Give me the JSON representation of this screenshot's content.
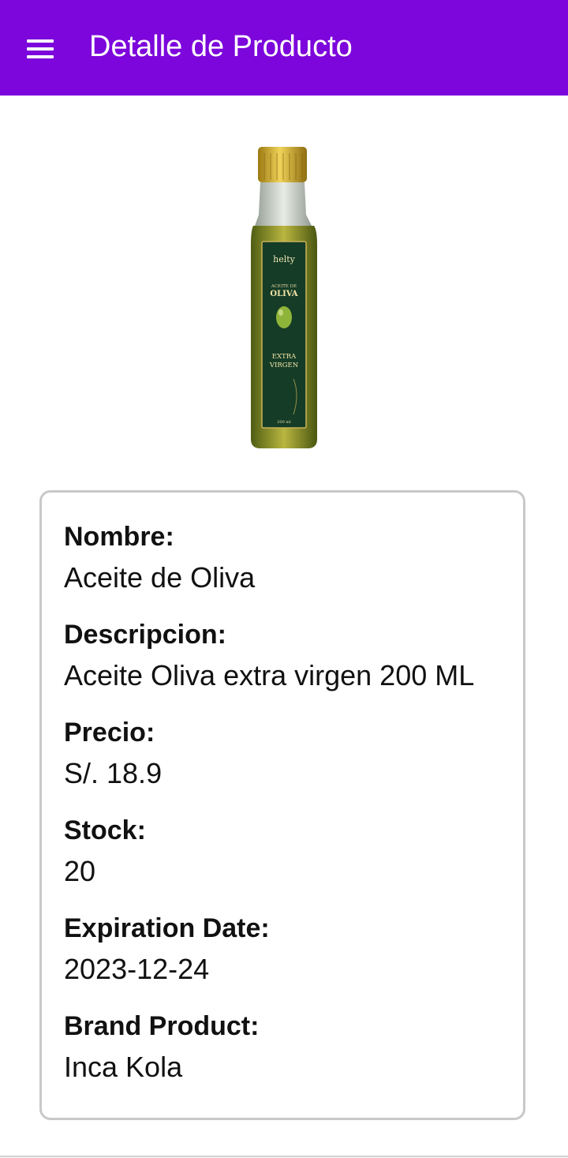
{
  "appbar": {
    "title": "Detalle de Producto",
    "menu_icon": "hamburger-menu-icon",
    "background_color": "#7c06db"
  },
  "product_image": {
    "brand_text": "helty",
    "label_small": "ACEITE DE",
    "label_big": "OLIVA",
    "label_extra": "EXTRA",
    "label_virgen": "VIRGEN",
    "label_volume": "200 ml"
  },
  "details": {
    "nombre": {
      "label": "Nombre:",
      "value": "Aceite de Oliva"
    },
    "descripcion": {
      "label": "Descripcion:",
      "value": "Aceite Oliva extra virgen 200 ML"
    },
    "precio": {
      "label": "Precio:",
      "value": "S/. 18.9"
    },
    "stock": {
      "label": "Stock:",
      "value": "20"
    },
    "expiration": {
      "label": "Expiration Date:",
      "value": "2023-12-24"
    },
    "brand": {
      "label": "Brand Product:",
      "value": "Inca Kola"
    }
  }
}
